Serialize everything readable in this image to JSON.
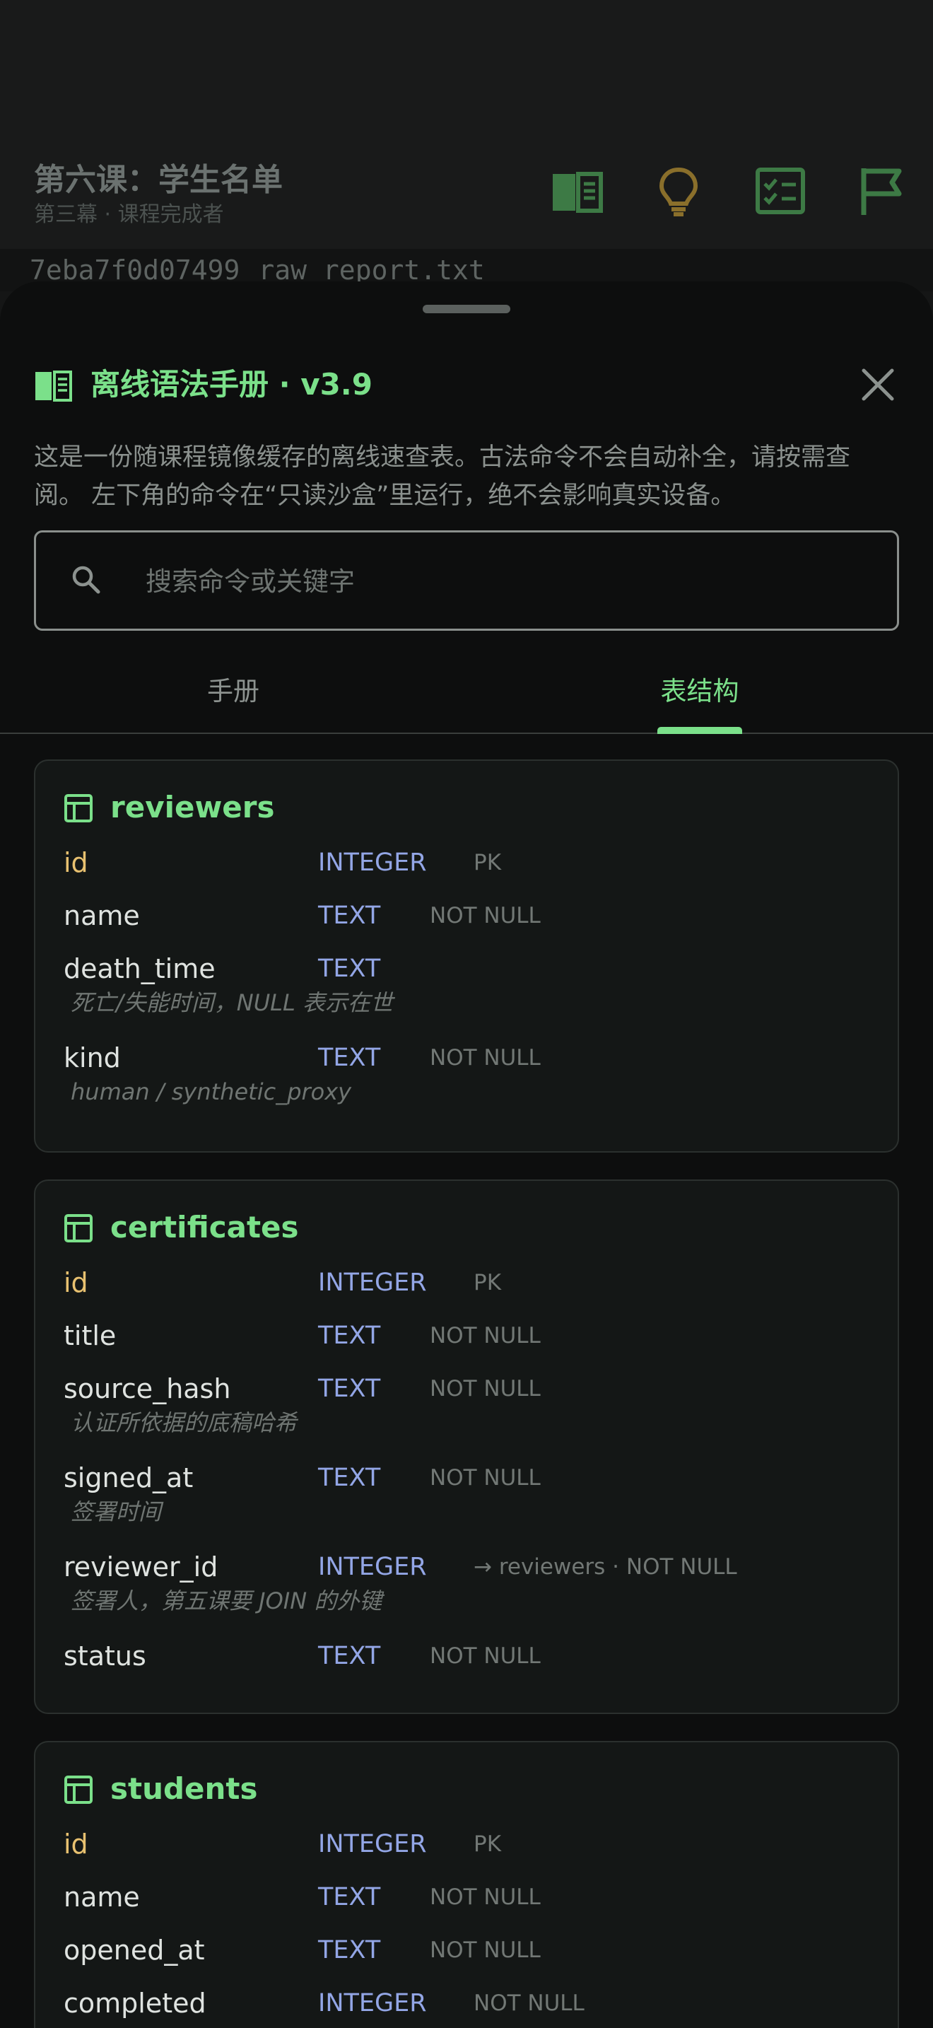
{
  "background": {
    "title": "第六课：学生名单",
    "subtitle": "第三幕 · 课程完成者",
    "icons": [
      "book-icon",
      "lightbulb-icon",
      "checklist-icon",
      "flag-icon"
    ],
    "file_hash": "7eba7f0d07499",
    "file_name": "raw_report.txt"
  },
  "sheet": {
    "title": "离线语法手册 · v3.9",
    "intro": "这是一份随课程镜像缓存的离线速查表。古法命令不会自动补全，请按需查阅。 左下角的命令在“只读沙盒”里运行，绝不会影响真实设备。",
    "search_placeholder": "搜索命令或关键字",
    "search_value": "",
    "tabs": [
      {
        "label": "手册",
        "active": false
      },
      {
        "label": "表结构",
        "active": true
      }
    ]
  },
  "tables": [
    {
      "name": "reviewers",
      "fields": [
        {
          "name": "id",
          "type": "INTEGER",
          "constraint": "PK",
          "note": ""
        },
        {
          "name": "name",
          "type": "TEXT",
          "constraint": "NOT NULL",
          "note": ""
        },
        {
          "name": "death_time",
          "type": "TEXT",
          "constraint": "",
          "note": "死亡/失能时间，NULL 表示在世"
        },
        {
          "name": "kind",
          "type": "TEXT",
          "constraint": "NOT NULL",
          "note": "human / synthetic_proxy"
        }
      ]
    },
    {
      "name": "certificates",
      "fields": [
        {
          "name": "id",
          "type": "INTEGER",
          "constraint": "PK",
          "note": ""
        },
        {
          "name": "title",
          "type": "TEXT",
          "constraint": "NOT NULL",
          "note": ""
        },
        {
          "name": "source_hash",
          "type": "TEXT",
          "constraint": "NOT NULL",
          "note": "认证所依据的底稿哈希"
        },
        {
          "name": "signed_at",
          "type": "TEXT",
          "constraint": "NOT NULL",
          "note": "签署时间"
        },
        {
          "name": "reviewer_id",
          "type": "INTEGER",
          "constraint": "→ reviewers · NOT NULL",
          "note": "签署人，第五课要 JOIN 的外键"
        },
        {
          "name": "status",
          "type": "TEXT",
          "constraint": "NOT NULL",
          "note": ""
        }
      ]
    },
    {
      "name": "students",
      "fields": [
        {
          "name": "id",
          "type": "INTEGER",
          "constraint": "PK",
          "note": ""
        },
        {
          "name": "name",
          "type": "TEXT",
          "constraint": "NOT NULL",
          "note": ""
        },
        {
          "name": "opened_at",
          "type": "TEXT",
          "constraint": "NOT NULL",
          "note": ""
        },
        {
          "name": "completed",
          "type": "INTEGER",
          "constraint": "NOT NULL",
          "note": ""
        }
      ]
    }
  ],
  "colors": {
    "accent": "#7be08a",
    "pk": "#e8c170",
    "type": "#93a6e6",
    "muted": "#727875"
  }
}
